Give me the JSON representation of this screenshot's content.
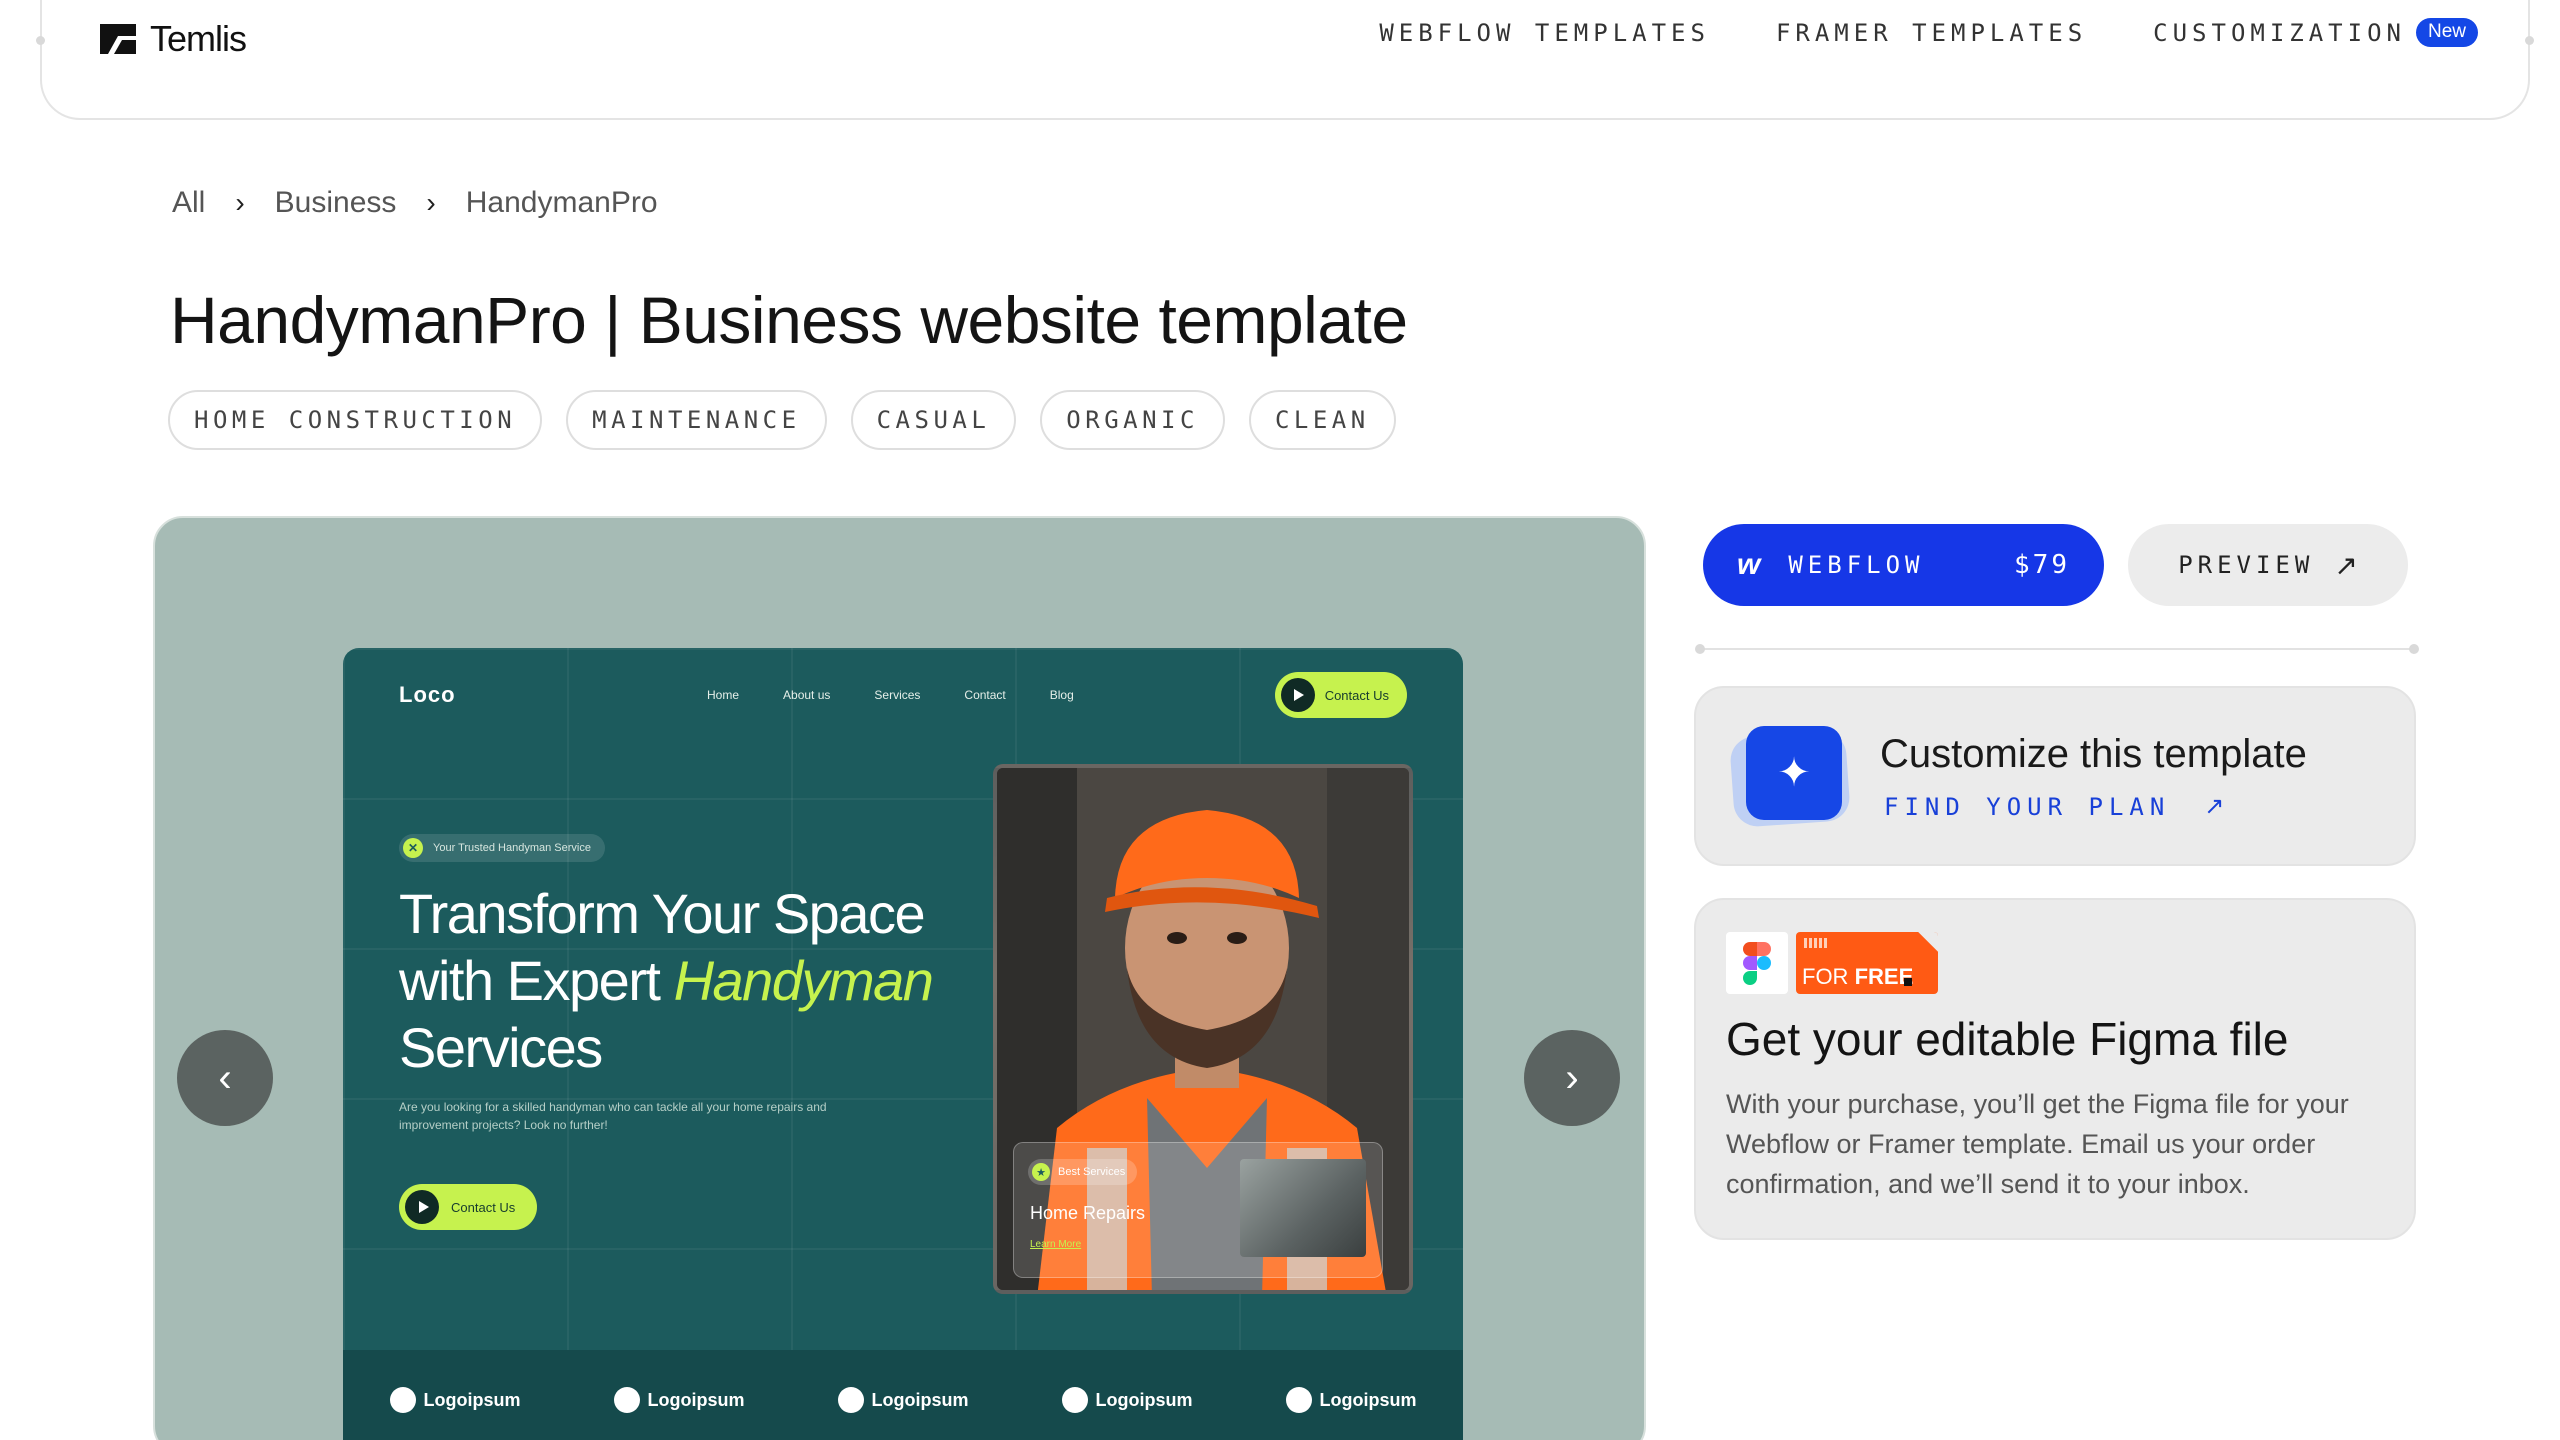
{
  "header": {
    "brand": "Temlis",
    "nav": [
      {
        "label": "WEBFLOW TEMPLATES"
      },
      {
        "label": "FRAMER TEMPLATES"
      },
      {
        "label": "CUSTOMIZATION",
        "badge": "New"
      }
    ]
  },
  "breadcrumb": [
    "All",
    "Business",
    "HandymanPro"
  ],
  "page": {
    "title": "HandymanPro | Business website template",
    "tags": [
      "HOME CONSTRUCTION",
      "MAINTENANCE",
      "CASUAL",
      "ORGANIC",
      "CLEAN"
    ]
  },
  "preview_site": {
    "logo": "Loᴄᴏ",
    "nav": [
      "Home",
      "About us",
      "Services",
      "Contact",
      "Blog"
    ],
    "cta": "Contact Us",
    "badge": "Your Trusted Handyman Service",
    "hero_line1": "Transform Your Space",
    "hero_line2_a": "with Expert ",
    "hero_line2_b": "Handyman",
    "hero_line3": "Services",
    "description": "Are you looking for a skilled handyman who can tackle all your home repairs and improvement projects? Look no further!",
    "cta2": "Contact Us",
    "service_badge": "Best Services",
    "service_title": "Home Repairs",
    "service_link": "Learn More",
    "logos": [
      "Logoipsum",
      "Logoipsum",
      "Logoipsum",
      "Logoipsum",
      "Logoipsum"
    ]
  },
  "purchase": {
    "platform": "WEBFLOW",
    "price": "$79",
    "preview": "PREVIEW"
  },
  "customize": {
    "title": "Customize this template",
    "link": "FIND YOUR PLAN"
  },
  "figma": {
    "badge": "FOR FREE",
    "badge_a": "FOR ",
    "badge_b": "FREE",
    "title": "Get your editable Figma file",
    "description": "With your purchase, you’ll get the Figma file for your Webflow or Framer template. Email us your order confirmation, and we’ll send it to your inbox."
  },
  "colors": {
    "accent": "#1637e7",
    "preview_bg": "#a6bbb5",
    "site_bg": "#1c5b5d",
    "site_accent": "#c6f24e",
    "free_badge": "#ff5a14"
  }
}
